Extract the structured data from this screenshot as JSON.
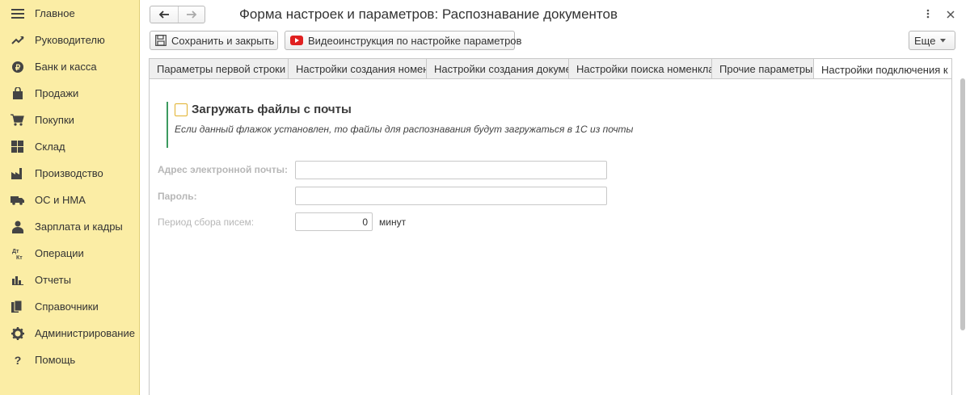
{
  "sidebar": {
    "items": [
      {
        "label": "Главное",
        "icon": "hamburger-icon"
      },
      {
        "label": "Руководителю",
        "icon": "trend-icon"
      },
      {
        "label": "Банк и касса",
        "icon": "coin-icon"
      },
      {
        "label": "Продажи",
        "icon": "bag-icon"
      },
      {
        "label": "Покупки",
        "icon": "cart-icon"
      },
      {
        "label": "Склад",
        "icon": "grid-icon"
      },
      {
        "label": "Производство",
        "icon": "factory-icon"
      },
      {
        "label": "ОС и НМА",
        "icon": "truck-icon"
      },
      {
        "label": "Зарплата и кадры",
        "icon": "person-icon"
      },
      {
        "label": "Операции",
        "icon": "debit-credit-icon"
      },
      {
        "label": "Отчеты",
        "icon": "bar-chart-icon"
      },
      {
        "label": "Справочники",
        "icon": "books-icon"
      },
      {
        "label": "Администрирование",
        "icon": "gear-icon"
      },
      {
        "label": "Помощь",
        "icon": "question-icon"
      }
    ]
  },
  "header": {
    "title": "Форма настроек и параметров: Распознавание документов"
  },
  "toolbar": {
    "save_label": "Сохранить и закрыть",
    "video_label": "Видеоинструкция по настройке параметров",
    "more_label": "Еще"
  },
  "tabs": [
    {
      "label": "Параметры первой строки"
    },
    {
      "label": "Настройки создания номенклатуры"
    },
    {
      "label": "Настройки создания документов"
    },
    {
      "label": "Настройки поиска номенклатуры"
    },
    {
      "label": "Прочие параметры"
    },
    {
      "label": "Настройки подключения к почте"
    }
  ],
  "form": {
    "checkbox_label": "Загружать файлы с почты",
    "checkbox_checked": false,
    "hint": "Если данный флажок установлен, то файлы для распознавания будут загружаться в 1С из почты",
    "email_label": "Адрес электронной почты:",
    "email_value": "",
    "password_label": "Пароль:",
    "password_value": "",
    "period_label": "Период сбора писем:",
    "period_value": "0",
    "period_unit": "минут"
  },
  "colors": {
    "sidebar_bg": "#fbeda5",
    "accent_green": "#3c9a5f",
    "youtube_red": "#e02020",
    "checkbox_border": "#e1b12c"
  }
}
